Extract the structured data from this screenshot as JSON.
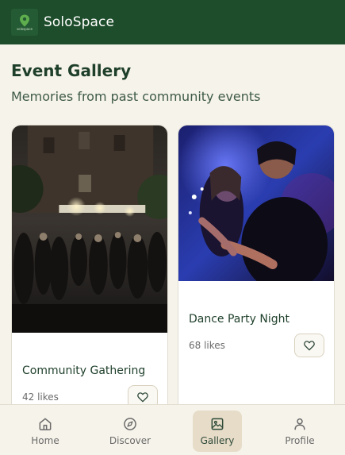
{
  "header": {
    "app_name": "SoloSpace",
    "logo_text": "solospace"
  },
  "page": {
    "title": "Event Gallery",
    "subtitle": "Memories from past community events"
  },
  "gallery": {
    "cards": [
      {
        "title": "Community Gathering",
        "likes": "42 likes",
        "image_icon": "photo-outdoor-crowd"
      },
      {
        "title": "Dance Party Night",
        "likes": "68 likes",
        "image_icon": "photo-dance-party"
      }
    ]
  },
  "nav": {
    "items": [
      {
        "label": "Home",
        "icon": "home-icon",
        "active": false
      },
      {
        "label": "Discover",
        "icon": "compass-icon",
        "active": false
      },
      {
        "label": "Gallery",
        "icon": "image-icon",
        "active": true
      },
      {
        "label": "Profile",
        "icon": "user-icon",
        "active": false
      }
    ]
  },
  "colors": {
    "header_bg": "#1e4d2b",
    "page_bg": "#f6f3ea",
    "active_nav_bg": "#e6dcc8",
    "title_text": "#1e3f2a"
  }
}
